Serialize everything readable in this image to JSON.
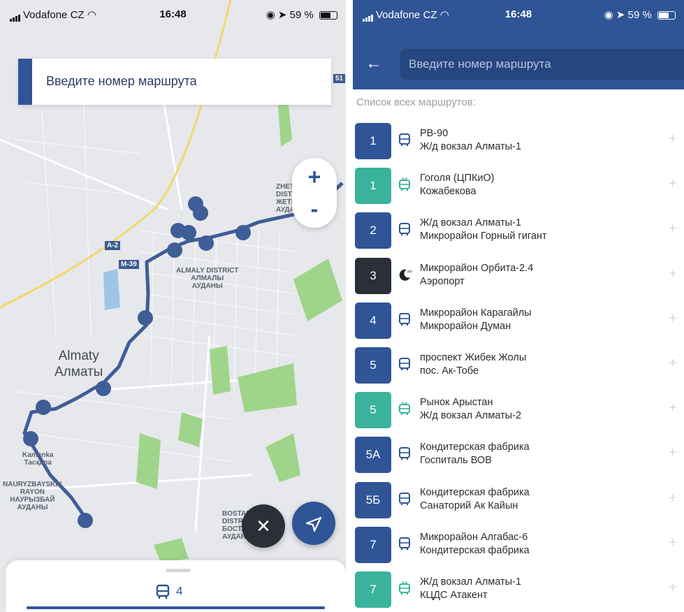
{
  "colors": {
    "primary": "#2f5596",
    "trolleybus": "#3ab39c",
    "night": "#2b2f37",
    "map_background": "#e6e8ec",
    "park_green": "#9fd58a",
    "water": "#9ec4e8",
    "highway": "#f3d86a"
  },
  "left_screen": {
    "status": {
      "carrier": "Vodafone CZ",
      "time": "16:48",
      "battery": "59 %"
    },
    "search": {
      "placeholder": "Введите номер маршрута"
    },
    "zoom": {
      "in_label": "+",
      "out_label": "-"
    },
    "map_labels": {
      "city_latin": "Almaty",
      "city_cyrillic": "Алматы",
      "almaly_district": [
        "ALMALY DISTRICT",
        "АЛМАЛЫ",
        "АУДАНЫ"
      ],
      "nauryzbay_district": [
        "NAURYZBAYSKIY",
        "RAYON",
        "НАУРЫЗБАЙ",
        "АУДАНЫ"
      ],
      "kamenka": [
        "Kamenka",
        "Тасқала"
      ],
      "zhetysu_district": [
        "ZHETYSU",
        "DISTRICT",
        "ЖЕТІСУ",
        "АУДАНЫ"
      ],
      "bostandyk_district": [
        "BOSTANDYK",
        "DISTRICT",
        "БОСТАНДЫҚ",
        "АУДАНЫ"
      ],
      "road_a2": "A-2",
      "road_m39": "M-39",
      "road_51": "51"
    },
    "bottom_sheet": {
      "vehicle_icon": "bus-icon",
      "count": "4"
    },
    "buttons": {
      "close_icon": "close-icon",
      "locate_icon": "navigation-arrow-icon"
    }
  },
  "right_screen": {
    "status": {
      "carrier": "Vodafone CZ",
      "time": "16:48",
      "battery": "59 %"
    },
    "back_icon": "arrow-left-icon",
    "search": {
      "placeholder": "Введите номер маршрута"
    },
    "list_title": "Список всех маршрутов:",
    "routes": [
      {
        "number": "1",
        "type": "bus",
        "from": "РВ-90",
        "to": "Ж/д вокзал Алматы-1"
      },
      {
        "number": "1",
        "type": "trolleybus",
        "from": "Гоголя (ЦПКиО)",
        "to": "Кожабекова"
      },
      {
        "number": "2",
        "type": "bus",
        "from": "Ж/д вокзал Алматы-1",
        "to": "Микрорайон Горный гигант"
      },
      {
        "number": "3",
        "type": "night",
        "from": "Микрорайон Орбита-2.4",
        "to": "Аэропорт"
      },
      {
        "number": "4",
        "type": "bus",
        "from": "Микрорайон Карагайлы",
        "to": "Микрорайон Думан"
      },
      {
        "number": "5",
        "type": "bus",
        "from": "проспект Жибек Жолы",
        "to": "пос. Ак-Тобе"
      },
      {
        "number": "5",
        "type": "trolleybus",
        "from": "Рынок Арыстан",
        "to": "Ж/д вокзал Алматы-2"
      },
      {
        "number": "5А",
        "type": "bus",
        "from": "Кондитерская фабрика",
        "to": "Госпиталь ВОВ"
      },
      {
        "number": "5Б",
        "type": "bus",
        "from": "Кондитерская фабрика",
        "to": "Санаторий Ак Кайын"
      },
      {
        "number": "7",
        "type": "bus",
        "from": "Микрорайон Алгабас-6",
        "to": "Кондитерская фабрика"
      },
      {
        "number": "7",
        "type": "trolleybus",
        "from": "Ж/д вокзал Алматы-1",
        "to": "КЦДС Атакент"
      }
    ],
    "add_label": "+"
  }
}
